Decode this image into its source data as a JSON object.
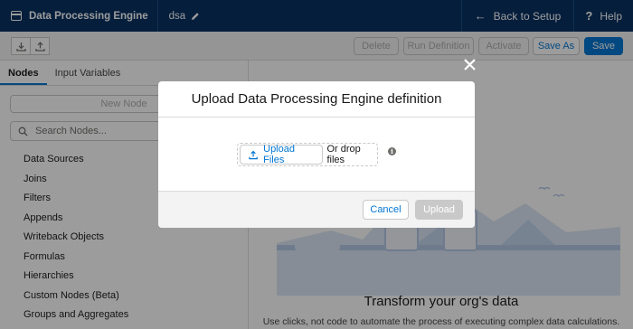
{
  "header": {
    "app_title": "Data Processing Engine",
    "definition_name": "dsa",
    "back_label": "Back to Setup",
    "help_label": "Help"
  },
  "toolbar": {
    "delete_label": "Delete",
    "run_label": "Run Definition",
    "activate_label": "Activate",
    "save_as_label": "Save As",
    "save_label": "Save"
  },
  "left_panel": {
    "tabs": [
      "Nodes",
      "Input Variables"
    ],
    "new_node_label": "New Node",
    "search_placeholder": "Search Nodes...",
    "node_types": [
      "Data Sources",
      "Joins",
      "Filters",
      "Appends",
      "Writeback Objects",
      "Formulas",
      "Hierarchies",
      "Custom Nodes (Beta)",
      "Groups and Aggregates"
    ]
  },
  "canvas": {
    "empty_title": "Transform your org's data",
    "empty_subtitle": "Use clicks, not code to automate the process of executing complex data calculations."
  },
  "modal": {
    "title": "Upload Data Processing Engine definition",
    "upload_files_label": "Upload Files",
    "drop_text": "Or drop files",
    "cancel_label": "Cancel",
    "upload_label": "Upload"
  },
  "colors": {
    "header_bg": "#032d60",
    "brand": "#0176d3",
    "disabled": "#c9c9c9"
  }
}
